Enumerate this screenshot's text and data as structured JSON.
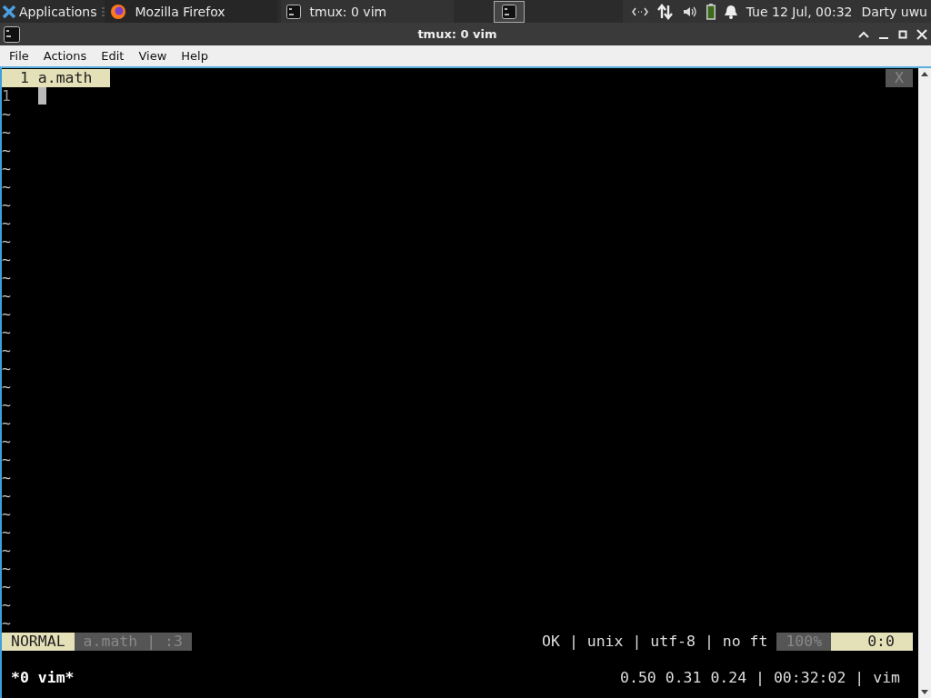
{
  "taskbar": {
    "menu": "Applications",
    "tasks": [
      {
        "label": "Mozilla Firefox",
        "kind": "browser",
        "selected": false
      },
      {
        "label": "tmux: 0 vim",
        "kind": "terminal",
        "selected": true
      }
    ],
    "clock": "Tue 12 Jul, 00:32",
    "user": "Darty uwu"
  },
  "window": {
    "title": "tmux: 0 vim"
  },
  "menubar": [
    "File",
    "Actions",
    "Edit",
    "View",
    "Help"
  ],
  "vim": {
    "tabline": {
      "tabs": [
        {
          "label": "1 a.math",
          "selected": true
        }
      ],
      "close": "X"
    },
    "lines": [
      {
        "number": "1"
      }
    ],
    "tildes": [
      "~",
      "~",
      "~",
      "~",
      "~",
      "~",
      "~",
      "~",
      "~",
      "~",
      "~",
      "~",
      "~",
      "~",
      "~",
      "~",
      "~",
      "~",
      "~",
      "~",
      "~",
      "~",
      "~",
      "~",
      "~",
      "~",
      "~",
      "~",
      "~"
    ],
    "statusline": {
      "mode": "NORMAL",
      "file": "a.math | :3",
      "info": "OK | unix | utf-8 | no ft",
      "percent": "100%",
      "cursor": "0:0"
    }
  },
  "tmux": {
    "window": "*0 vim*",
    "status": "0.50 0.31 0.24 | 00:32:02 | vim"
  }
}
